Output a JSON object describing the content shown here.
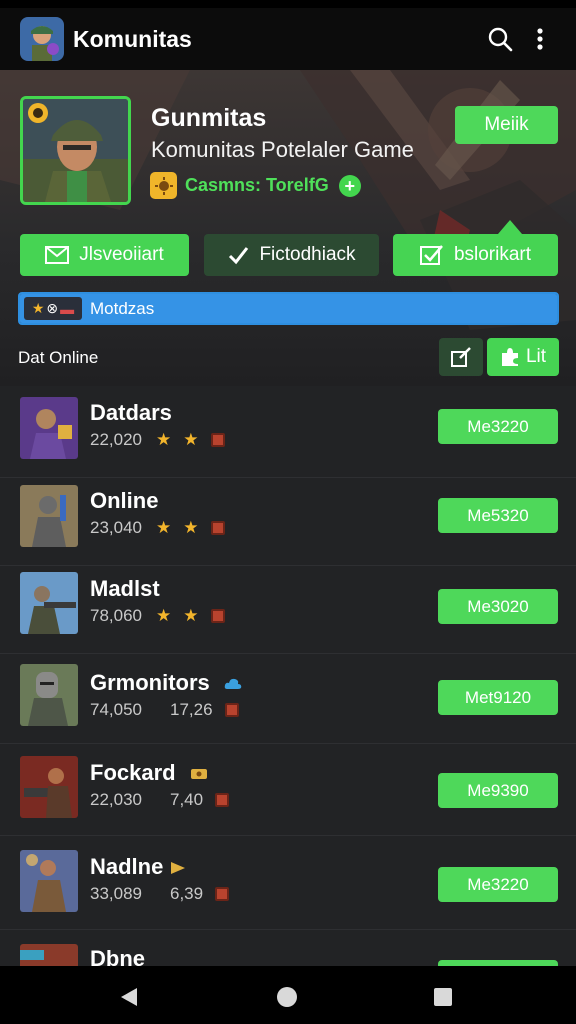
{
  "app_bar": {
    "title": "Komunitas",
    "search_icon": "search-icon",
    "menu_icon": "more-vert-icon"
  },
  "game": {
    "name": "Gunmitas",
    "subtitle": "Komunitas Potelaler Game",
    "stat_text": "Casmns: TorelfG",
    "follow_label": "Meiik"
  },
  "actions": [
    {
      "label": "Jlsveoiiart",
      "icon": "mail-icon"
    },
    {
      "label": "Fictodhiack",
      "icon": "check-icon"
    },
    {
      "label": "bslorikart",
      "icon": "checkbox-icon"
    }
  ],
  "progress": {
    "label": "Motdzas",
    "fraction": 1.0
  },
  "section": {
    "title": "Dat Online",
    "list_label": "Lit"
  },
  "rows": [
    {
      "name": "Datdars",
      "meta": "22,020",
      "button": "Me3220"
    },
    {
      "name": "Online",
      "meta": "23,040",
      "button": "Me5320"
    },
    {
      "name": "Madlst",
      "meta": "78,060",
      "button": "Me3020"
    },
    {
      "name": "Grmonitors",
      "meta": "74,050",
      "meta2": "17,26",
      "button": "Met9120"
    },
    {
      "name": "Fockard",
      "meta": "22,030",
      "meta2": "7,40",
      "button": "Me9390"
    },
    {
      "name": "Nadlne",
      "meta": "33,089",
      "meta2": "6,39",
      "button": "Me3220"
    },
    {
      "name": "Dbne",
      "meta": "",
      "button": ""
    }
  ],
  "colors": {
    "accent_green": "#4ed85a",
    "dark_green": "#2c4a32",
    "progress_blue": "#3593e6",
    "list_bg": "#222325"
  }
}
